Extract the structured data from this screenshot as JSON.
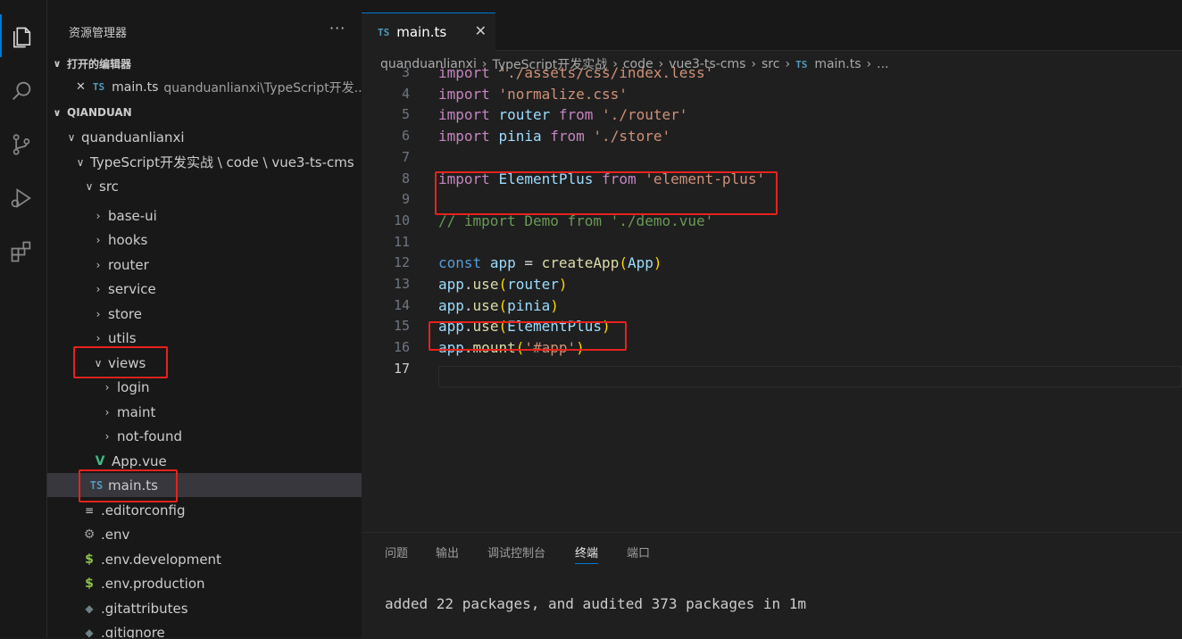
{
  "explorer": {
    "title": "资源管理器",
    "more": "···",
    "open_editors_label": "打开的编辑器",
    "open_editor": {
      "close": "✕",
      "badge": "TS",
      "name": "main.ts",
      "path": "quanduanlianxi\\TypeScript开发..."
    },
    "workspace_label": "QIANDUAN",
    "tree": [
      {
        "label": "quanduanlianxi",
        "chev": "∨"
      },
      {
        "label": "TypeScript开发实战 \\ code \\ vue3-ts-cms",
        "chev": "∨"
      },
      {
        "label": "src",
        "chev": "∨"
      },
      {
        "label": "base-ui",
        "chev": "›"
      },
      {
        "label": "hooks",
        "chev": "›"
      },
      {
        "label": "router",
        "chev": "›"
      },
      {
        "label": "service",
        "chev": "›"
      },
      {
        "label": "store",
        "chev": "›"
      },
      {
        "label": "utils",
        "chev": "›"
      },
      {
        "label": "views",
        "chev": "∨"
      },
      {
        "label": "login",
        "chev": "›"
      },
      {
        "label": "maint",
        "chev": "›"
      },
      {
        "label": "not-found",
        "chev": "›"
      },
      {
        "label": "App.vue",
        "icon": "V"
      },
      {
        "label": "main.ts",
        "icon": "TS"
      },
      {
        "label": ".editorconfig",
        "icon": "≡"
      },
      {
        "label": ".env",
        "icon": "⚙"
      },
      {
        "label": ".env.development",
        "icon": "$"
      },
      {
        "label": ".env.production",
        "icon": "$"
      },
      {
        "label": ".gitattributes",
        "icon": "◆"
      },
      {
        "label": ".gitignore",
        "icon": "◆"
      }
    ]
  },
  "editor": {
    "tab": {
      "badge": "TS",
      "name": "main.ts",
      "close": "✕"
    },
    "breadcrumb": [
      "quanduanlianxi",
      "TypeScript开发实战",
      "code",
      "vue3-ts-cms",
      "src"
    ],
    "breadcrumb_file": {
      "badge": "TS",
      "name": "main.ts"
    },
    "breadcrumb_tail": "...",
    "lines": [
      {
        "n": "3",
        "tokens": [
          [
            "kw",
            "import"
          ],
          [
            "pn",
            " "
          ],
          [
            "str",
            "'./assets/css/index.less'"
          ]
        ]
      },
      {
        "n": "4",
        "tokens": [
          [
            "kw",
            "import"
          ],
          [
            "pn",
            " "
          ],
          [
            "str",
            "'normalize.css'"
          ]
        ]
      },
      {
        "n": "5",
        "tokens": [
          [
            "kw",
            "import"
          ],
          [
            "pn",
            " "
          ],
          [
            "id",
            "router"
          ],
          [
            "pn",
            " "
          ],
          [
            "kw",
            "from"
          ],
          [
            "pn",
            " "
          ],
          [
            "str",
            "'./router'"
          ]
        ]
      },
      {
        "n": "6",
        "tokens": [
          [
            "kw",
            "import"
          ],
          [
            "pn",
            " "
          ],
          [
            "id",
            "pinia"
          ],
          [
            "pn",
            " "
          ],
          [
            "kw",
            "from"
          ],
          [
            "pn",
            " "
          ],
          [
            "str",
            "'./store'"
          ]
        ]
      },
      {
        "n": "7",
        "tokens": []
      },
      {
        "n": "8",
        "tokens": [
          [
            "kw",
            "import"
          ],
          [
            "pn",
            " "
          ],
          [
            "id",
            "ElementPlus"
          ],
          [
            "pn",
            " "
          ],
          [
            "kw",
            "from"
          ],
          [
            "pn",
            " "
          ],
          [
            "str",
            "'element-plus'"
          ]
        ]
      },
      {
        "n": "9",
        "tokens": []
      },
      {
        "n": "10",
        "tokens": [
          [
            "cm",
            "// import Demo from './demo.vue'"
          ]
        ]
      },
      {
        "n": "11",
        "tokens": []
      },
      {
        "n": "12",
        "tokens": [
          [
            "kw2",
            "const"
          ],
          [
            "pn",
            " "
          ],
          [
            "id",
            "app"
          ],
          [
            "pn",
            " = "
          ],
          [
            "fn",
            "createApp"
          ],
          [
            "br1",
            "("
          ],
          [
            "id",
            "App"
          ],
          [
            "br1",
            ")"
          ]
        ]
      },
      {
        "n": "13",
        "tokens": [
          [
            "id",
            "app"
          ],
          [
            "pn",
            "."
          ],
          [
            "fn",
            "use"
          ],
          [
            "br1",
            "("
          ],
          [
            "id",
            "router"
          ],
          [
            "br1",
            ")"
          ]
        ]
      },
      {
        "n": "14",
        "tokens": [
          [
            "id",
            "app"
          ],
          [
            "pn",
            "."
          ],
          [
            "fn",
            "use"
          ],
          [
            "br1",
            "("
          ],
          [
            "id",
            "pinia"
          ],
          [
            "br1",
            ")"
          ]
        ]
      },
      {
        "n": "15",
        "tokens": [
          [
            "id",
            "app"
          ],
          [
            "pn",
            "."
          ],
          [
            "fn",
            "use"
          ],
          [
            "br1",
            "("
          ],
          [
            "id",
            "ElementPlus"
          ],
          [
            "br1",
            ")"
          ]
        ]
      },
      {
        "n": "16",
        "tokens": [
          [
            "id",
            "app"
          ],
          [
            "pn",
            "."
          ],
          [
            "fn",
            "mount"
          ],
          [
            "br1",
            "("
          ],
          [
            "str",
            "'#app'"
          ],
          [
            "br1",
            ")"
          ]
        ]
      },
      {
        "n": "17",
        "tokens": []
      }
    ]
  },
  "panel": {
    "tabs": [
      "问题",
      "输出",
      "调试控制台",
      "终端",
      "端口"
    ],
    "active_tab": "终端",
    "terminal": [
      "added 22 packages, and audited 373 packages in 1m"
    ]
  },
  "colors": {
    "accent": "#0078d4",
    "highlight_box": "#e5231c"
  }
}
